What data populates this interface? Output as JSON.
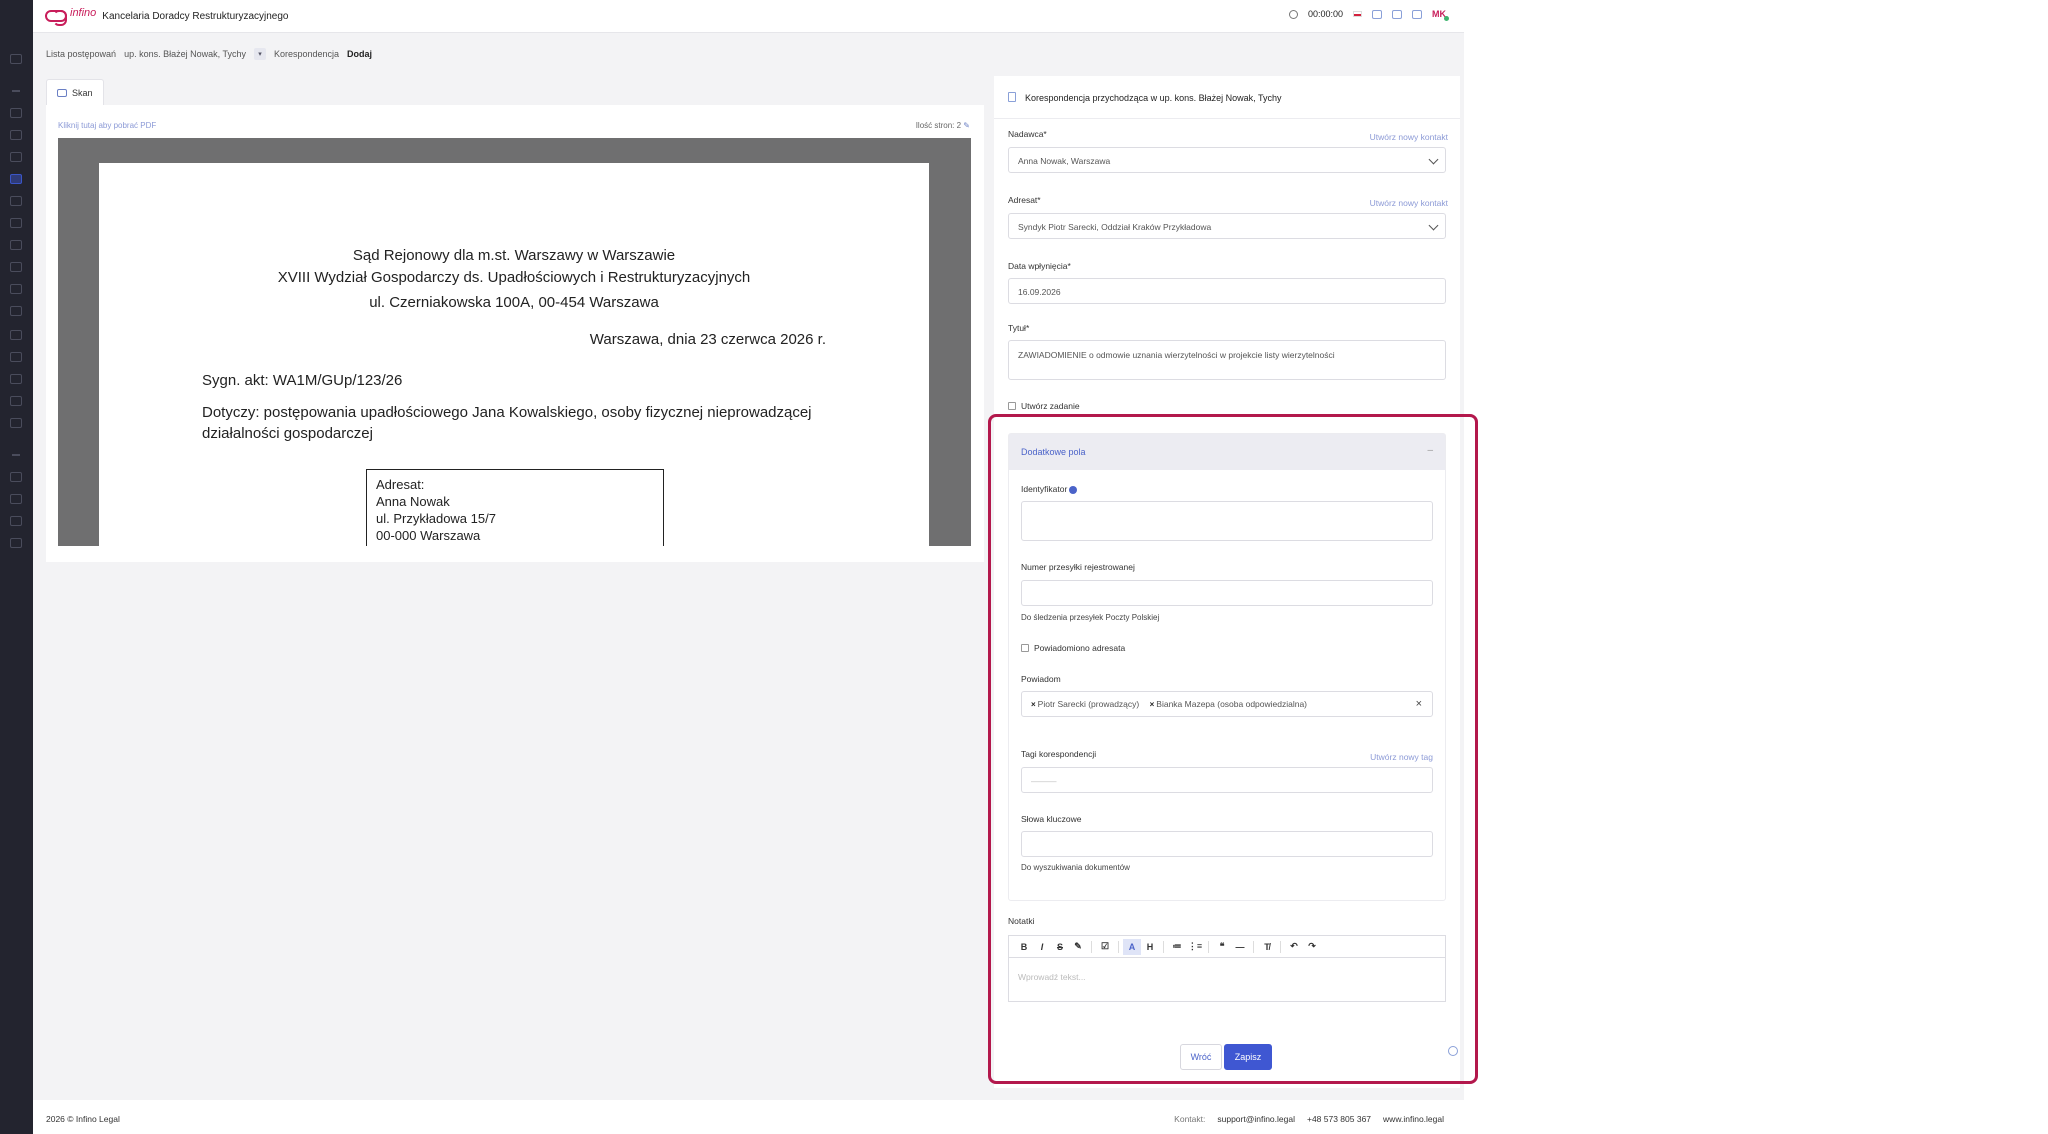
{
  "app": {
    "logo_text": "infino",
    "firm_name": "Kancelaria Doradcy Restrukturyzacyjnego",
    "timer": "00:00:00",
    "avatar_initials": "MK"
  },
  "breadcrumb": {
    "list": "Lista postępowań",
    "case": "up. kons. Błażej Nowak, Tychy",
    "section": "Korespondencja",
    "current": "Dodaj"
  },
  "scan": {
    "tab_label": "Skan",
    "pdf_link": "Kliknij tutaj aby pobrać PDF",
    "pages": "Ilość stron: 2",
    "document": {
      "court_1": "Sąd Rejonowy dla m.st. Warszawy w Warszawie",
      "court_2": "XVIII Wydział Gospodarczy ds. Upadłościowych i Restrukturyzacyjnych",
      "court_3": "ul. Czerniakowska 100A, 00-454 Warszawa",
      "date": "Warszawa, dnia 23 czerwca 2026 r.",
      "sygn": "Sygn. akt: WA1M/GUp/123/26",
      "dotyczy": "Dotyczy: postępowania upadłościowego Jana Kowalskiego, osoby fizycznej nieprowadzącej działalności gospodarczej",
      "addr_1": "Adresat:",
      "addr_2": "Anna Nowak",
      "addr_3": "ul. Przykładowa 15/7",
      "addr_4": "00-000 Warszawa"
    }
  },
  "form": {
    "title": "Korespondencja przychodząca w up. kons. Błażej Nowak, Tychy",
    "nadawca_label": "Nadawca*",
    "nadawca_value": "Anna Nowak, Warszawa",
    "new_contact_1": "Utwórz nowy kontakt",
    "adresat_label": "Adresat*",
    "adresat_value": "Syndyk Piotr Sarecki, Oddział Kraków Przykładowa",
    "new_contact_2": "Utwórz nowy kontakt",
    "date_label": "Data wpłynięcia*",
    "date_value": "16.09.2026",
    "title_label": "Tytuł*",
    "title_value": "ZAWIADOMIENIE o odmowie uznania wierzytelności w projekcie listy wierzytelności",
    "create_task": "Utwórz zadanie",
    "extra": {
      "header": "Dodatkowe pola",
      "collapse": "–",
      "identifier_label": "Identyfikator",
      "tracking_label": "Numer przesyłki rejestrowanej",
      "tracking_help": "Do śledzenia przesyłek Poczty Polskiej",
      "notified_label": "Powiadomiono adresata",
      "notify_label": "Powiadom",
      "notify_tags": [
        "Piotr Sarecki (prowadzący)",
        "Bianka Mazepa (osoba odpowiedzialna)"
      ],
      "tags_label": "Tagi korespondencji",
      "new_tag": "Utwórz nowy tag",
      "tags_placeholder": "———",
      "keywords_label": "Słowa kluczowe",
      "keywords_help": "Do wyszukiwania dokumentów"
    },
    "notes_label": "Notatki",
    "notes_placeholder": "Wprowadź tekst...",
    "toolbar": [
      "B",
      "I",
      "S",
      "✎",
      "☑",
      "A",
      "H",
      "≔",
      "⋮≡",
      "❝",
      "—",
      "T̸",
      "↶",
      "↷"
    ],
    "back": "Wróć",
    "save": "Zapisz"
  },
  "footer": {
    "copyright": "2026 © Infino Legal",
    "contact_label": "Kontakt:",
    "email": "support@infino.legal",
    "phone": "+48 573 805 367",
    "website": "www.infino.legal"
  },
  "colors": {
    "accent": "#3f57d2",
    "brand": "#c81d5a",
    "highlight": "#b3184c",
    "rail": "#23242f"
  }
}
